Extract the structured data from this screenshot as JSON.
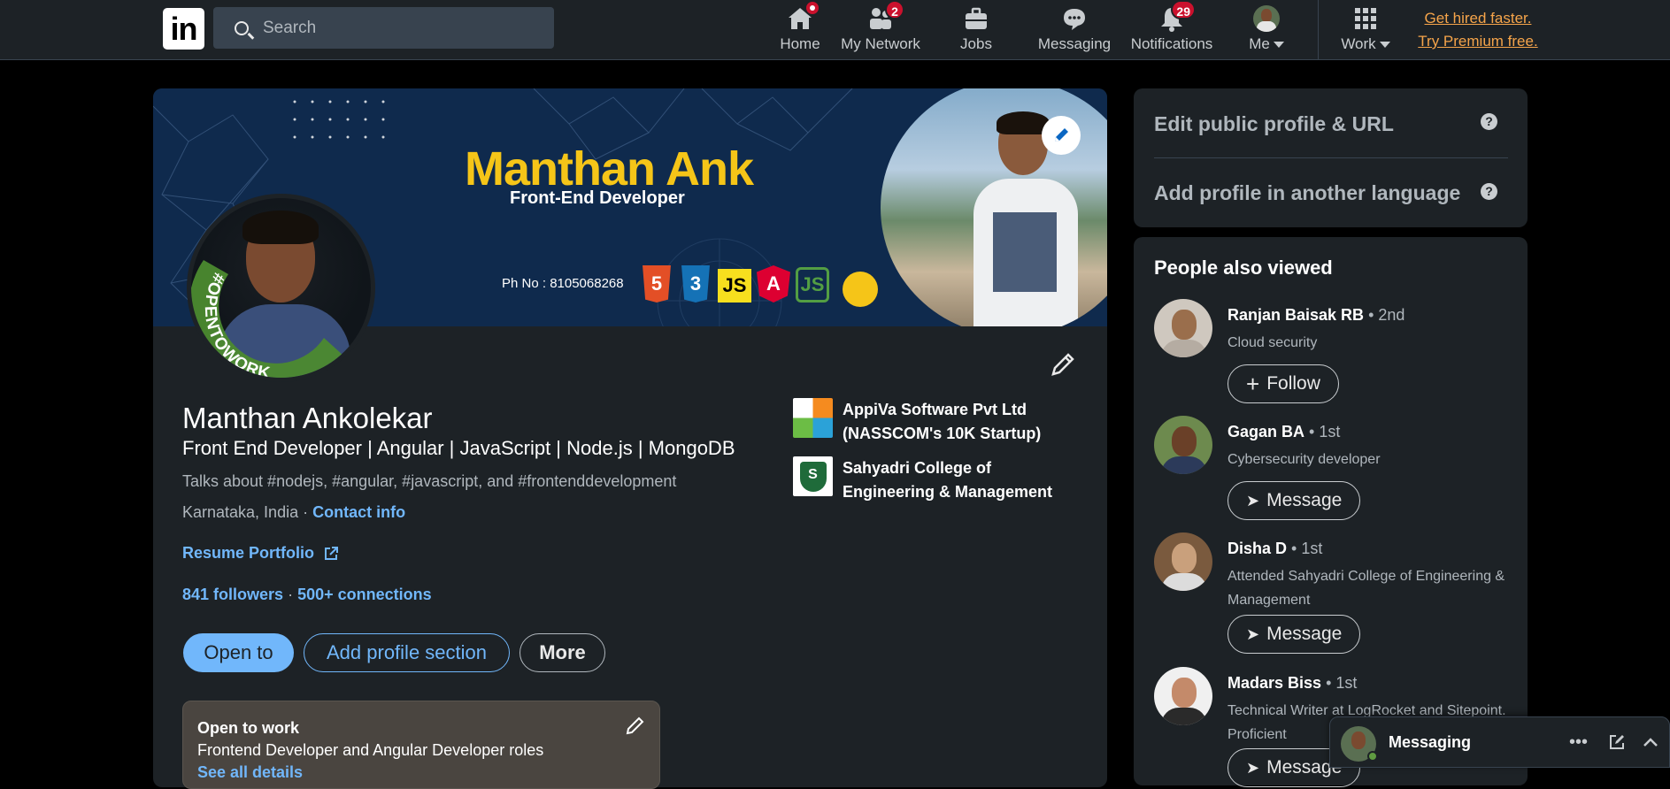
{
  "nav": {
    "logo": "in",
    "search_placeholder": "Search",
    "items": [
      {
        "label": "Home",
        "badge": ""
      },
      {
        "label": "My Network",
        "badge": "2"
      },
      {
        "label": "Jobs",
        "badge": ""
      },
      {
        "label": "Messaging",
        "badge": ""
      },
      {
        "label": "Notifications",
        "badge": "29"
      },
      {
        "label": "Me",
        "badge": ""
      },
      {
        "label": "Work",
        "badge": ""
      }
    ],
    "premium_line1": "Get hired faster.",
    "premium_line2": "Try Premium free."
  },
  "banner": {
    "title": "Manthan Ank",
    "subtitle": "Front-End Developer",
    "phone": "Ph No : 8105068268",
    "tech": [
      "5",
      "3",
      "JS",
      "A",
      "JS"
    ]
  },
  "profile": {
    "badge_text": "#OPENTOWORK",
    "name": "Manthan Ankolekar",
    "headline": "Front End Developer | Angular | JavaScript | Node.js | MongoDB",
    "talks": "Talks about #nodejs, #angular, #javascript, and #frontenddevelopment",
    "location": "Karnataka, India",
    "location_sep": " · ",
    "contact": "Contact info",
    "resume": "Resume Portfolio",
    "followers": "841 followers",
    "connections": "500+ connections",
    "btn_open": "Open to",
    "btn_add": "Add profile section",
    "btn_more": "More",
    "otw_title": "Open to work",
    "otw_desc": "Frontend Developer and Angular Developer roles",
    "otw_link": "See all details",
    "experience": [
      {
        "line1": "AppiVa Software Pvt Ltd",
        "line2": "(NASSCOM's 10K Startup)"
      },
      {
        "line1": "Sahyadri College of",
        "line2": "Engineering & Management"
      }
    ]
  },
  "side": {
    "edit_url": "Edit public profile & URL",
    "add_lang": "Add profile in another language",
    "help": "?",
    "pav_title": "People also viewed",
    "people": [
      {
        "name": "Ranjan Baisak RB",
        "degree": " • 2nd",
        "desc": "Cloud security",
        "action": "Follow",
        "action_icon": "+"
      },
      {
        "name": "Gagan BA",
        "degree": " • 1st",
        "desc": "Cybersecurity developer",
        "action": "Message",
        "action_icon": "➤"
      },
      {
        "name": "Disha D",
        "degree": " • 1st",
        "desc": "Attended Sahyadri College of Engineering & Management",
        "action": "Message",
        "action_icon": "➤"
      },
      {
        "name": "Madars Biss",
        "degree": " • 1st",
        "desc": "Technical Writer at LogRocket and Sitepoint. Proficient",
        "action": "Message",
        "action_icon": "➤"
      }
    ]
  },
  "messaging": {
    "label": "Messaging"
  },
  "colors": {
    "accent": "#71b7fb",
    "premium": "#f5a44a",
    "card": "#1d2226",
    "badge": "#cb112d",
    "otw_green": "#5f9b41"
  }
}
